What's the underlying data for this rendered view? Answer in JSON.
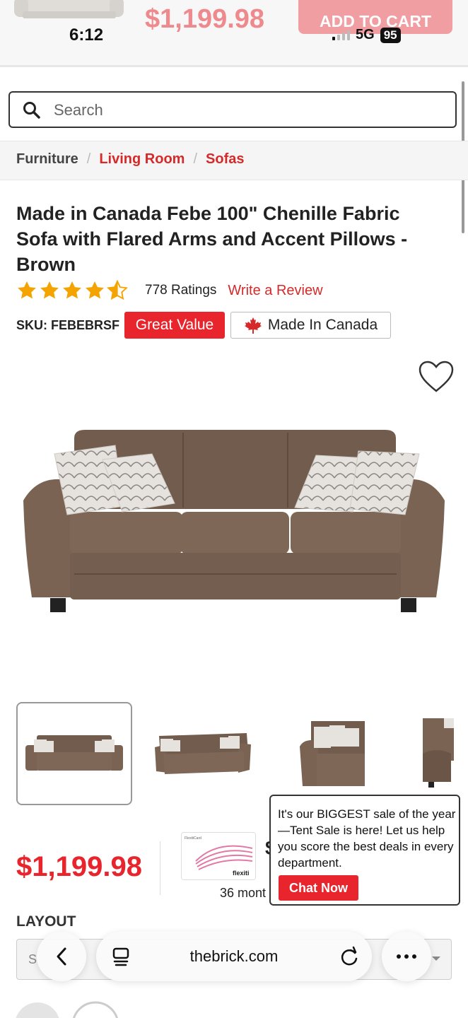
{
  "status": {
    "time": "6:12",
    "network": "5G",
    "battery": "95"
  },
  "sticky": {
    "price": "$1,199.98",
    "cta": "ADD TO CART"
  },
  "search": {
    "placeholder": "Search"
  },
  "breadcrumb": [
    "Furniture",
    "Living Room",
    "Sofas"
  ],
  "product": {
    "title": "Made in Canada Febe 100\" Chenille Fabric Sofa with Flared Arms and Accent Pillows - Brown",
    "rating_value": 4.5,
    "rating_count": "778 Ratings",
    "write_review": "Write a Review",
    "sku": "SKU: FEBEBRSF",
    "badge_value": "Great Value",
    "badge_origin": "Made In Canada",
    "price": "$1,199.98"
  },
  "financing": {
    "months_text": "36 mont",
    "card_brand": "flexiti",
    "card_label": "FlexitiCard"
  },
  "chat": {
    "message": "It's our BIGGEST sale of the year—Tent Sale is here! Let us help you score the best deals in every department.",
    "button": "Chat Now"
  },
  "layout": {
    "label": "LAYOUT",
    "selected": "S"
  },
  "browser": {
    "url": "thebrick.com"
  },
  "colors": {
    "brand_red": "#e8242c",
    "sofa_brown": "#7a6352",
    "pillow": "#e4e0dc"
  },
  "icons": [
    "search-icon",
    "star-icon",
    "maple-leaf-icon",
    "heart-icon",
    "back-icon",
    "tabs-icon",
    "reload-icon",
    "more-icon",
    "chevron-down-icon"
  ]
}
